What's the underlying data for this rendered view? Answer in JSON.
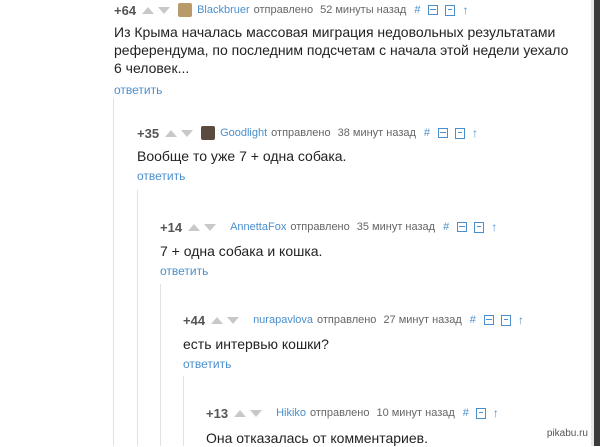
{
  "sent_label": "отправлено",
  "reply_label": "ответить",
  "tools": {
    "hash": "#",
    "up": "↑"
  },
  "colors": {
    "link": "#4a8fcc",
    "vote_arrow": "#c8c8c8",
    "thread_line": "#e2e2e2"
  },
  "comments": [
    {
      "rating": "+64",
      "author": "Blackbruer",
      "time": "52 минуты назад",
      "text": "Из Крыма началась массовая миграция недовольных результатами референдума, по последним подсчетам с начала этой недели уехало 6 человек...",
      "avatar_icon": "user-avatar-icon"
    },
    {
      "rating": "+35",
      "author": "Goodlight",
      "time": "38 минут назад",
      "text": "Вообще то уже 7 + одна собака.",
      "avatar_icon": "user-avatar-icon"
    },
    {
      "rating": "+14",
      "author": "AnnettaFox",
      "time": "35 минут назад",
      "text": "7 + одна собака и кошка."
    },
    {
      "rating": "+44",
      "author": "nurapavlova",
      "time": "27 минут назад",
      "text": "есть интервью кошки?"
    },
    {
      "rating": "+13",
      "author": "Hikiko",
      "time": "10 минут назад",
      "text": "Она отказалась от комментариев."
    }
  ],
  "watermark": "pikabu.ru"
}
